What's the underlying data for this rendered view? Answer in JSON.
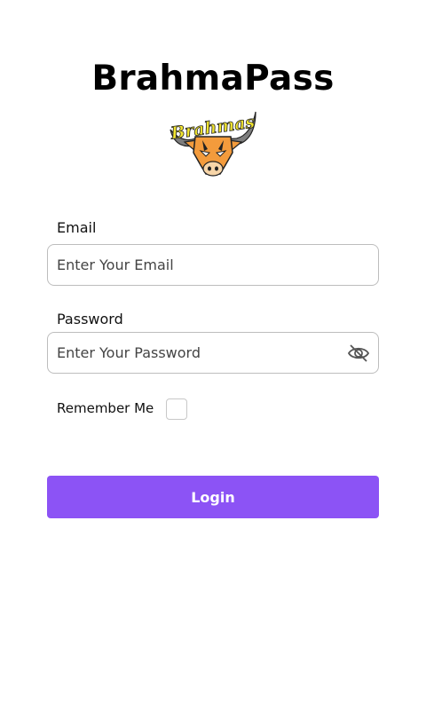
{
  "app": {
    "title": "BrahmaPass",
    "logo_text": "Brahmas"
  },
  "form": {
    "email_label": "Email",
    "email_placeholder": "Enter Your Email",
    "email_value": "",
    "password_label": "Password",
    "password_placeholder": "Enter Your Password",
    "password_value": "",
    "password_visibility_icon": "eye-off-icon",
    "remember_label": "Remember Me",
    "remember_checked": false,
    "login_label": "Login"
  },
  "colors": {
    "primary": "#8c53f5",
    "logo_accent": "#f2e530",
    "logo_orange": "#f39b3c"
  }
}
